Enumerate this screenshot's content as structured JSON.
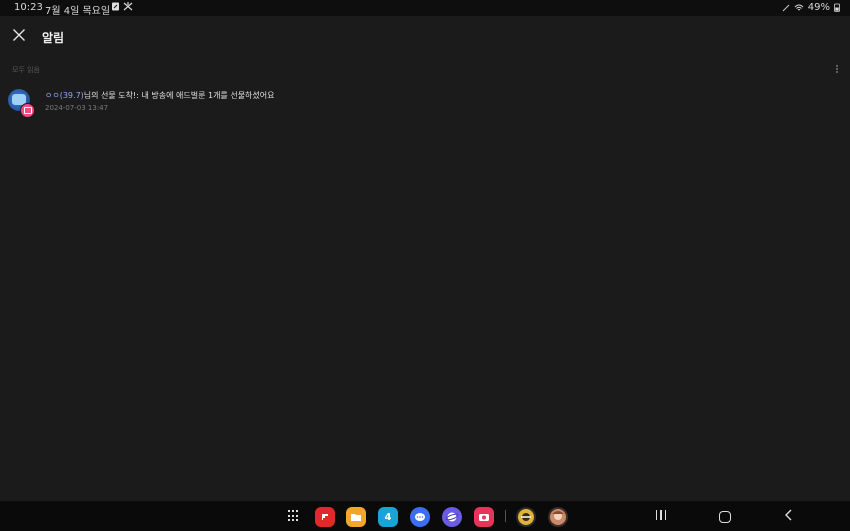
{
  "status_bar": {
    "time": "10:23",
    "date": "7월 4일 목요일",
    "battery": "49%",
    "icons_left": [
      "note-icon",
      "mute-icon"
    ],
    "icons_right": [
      "pen-icon",
      "wifi-icon",
      "battery-icon"
    ]
  },
  "header": {
    "title": "알림",
    "close_icon": "close-icon"
  },
  "section": {
    "label": "모두 읽음"
  },
  "notifications": [
    {
      "sender": "ㅇㅇ(39.7)",
      "message": "님의 선물 도착!: 내 방송에 애드벌룬 1개를 선물하셨어요",
      "time": "2024-07-03 13:47",
      "badge_icon": "gift-icon"
    }
  ],
  "taskbar": {
    "apps": [
      {
        "name": "flipboard-icon",
        "color": "#e02a2a"
      },
      {
        "name": "my-files-icon",
        "color": "#f2a72a"
      },
      {
        "name": "calendar-icon",
        "color": "#1aa3d6"
      },
      {
        "name": "messages-icon",
        "color": "#3b6ff0"
      },
      {
        "name": "internet-icon",
        "color": "#6a5ce0"
      },
      {
        "name": "screen-recorder-icon",
        "color": "#e8345a"
      },
      {
        "name": "game-icon-1",
        "color": "#e0b43a"
      },
      {
        "name": "game-icon-2",
        "color": "#c98b6a"
      }
    ],
    "calendar_day": "4"
  },
  "colors": {
    "background": "#1b1b1b",
    "sender_accent": "#8fa8ff",
    "badge": "#ef4f7f"
  }
}
